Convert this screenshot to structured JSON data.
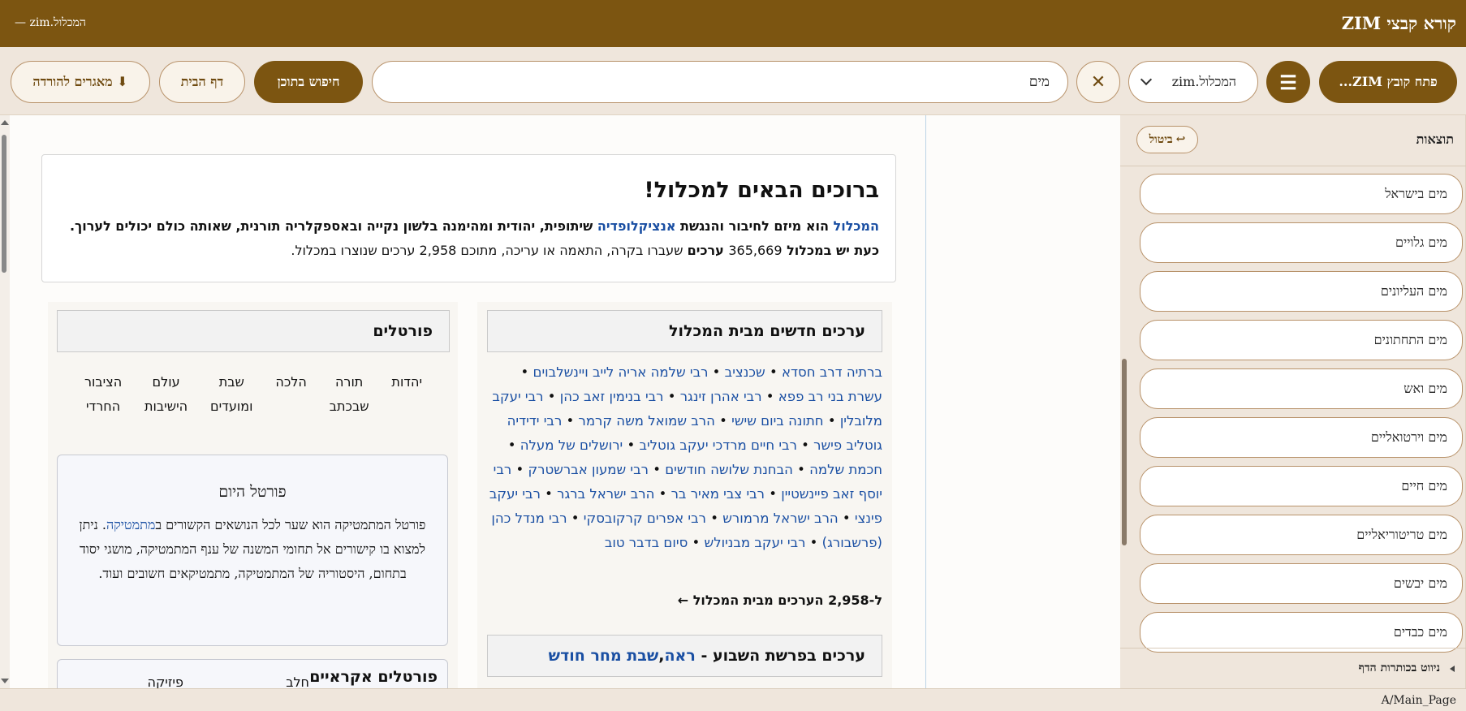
{
  "window": {
    "app_title": "קורא קבצי ZIM",
    "doc_title": "המכלול.zim —"
  },
  "toolbar": {
    "open_label": "פתח קובץ ZIM...",
    "menu_glyph": "☰",
    "zim_selected": "המכלול.zim",
    "clear_glyph": "✕",
    "search_value": "מים",
    "fulltext_label": "חיפוש בתוכן",
    "home_label": "דף הבית",
    "repo_label": "⬇ מאגרים להורדה"
  },
  "welcome": {
    "title": "ברוכים הבאים למכלול!",
    "link_hamichlol": "המכלול",
    "text_1": " הוא מיזם לחיבור והנגשת ",
    "link_encyclopedia": "אנציקלופדיה",
    "text_2": " שיתופית, יהודית ומהימנה בלשון נקייה ובאספקלריה תורנית, שאותה כולם יכולים לערוך. כעת יש במכלול ",
    "count_total": "365,669",
    "text_3": " ערכים",
    "text_4": " שעברו בקרה, התאמה או עריכה, מתוכם ",
    "count_created": "2,958",
    "text_5": " ערכים שנוצרו במכלול."
  },
  "new_articles": {
    "heading": "ערכים חדשים מבית המכלול",
    "items": [
      "ברתיה דרב חסדא",
      "שכנציב",
      "רבי שלמה אריה לייב ויינשלבוים",
      "עשרת בני רב פפא",
      "רבי אהרן זינגר",
      "רבי בנימין זאב כהן",
      "רבי יעקב מלובלין",
      "חתונה ביום שישי",
      "הרב שמואל משה קרמר",
      "רבי ידידיה גוטליב פישר",
      "רבי חיים מרדכי יעקב גוטליב",
      "ירושלים של מעלה",
      "חכמת שלמה",
      "הבחנת שלושה חודשים",
      "רבי שמעון אברשטרק",
      "רבי יוסף זאב פיינשטיין",
      "רבי צבי מאיר בר",
      "הרב ישראל ברגר",
      "רבי יעקב פינצי",
      "הרב ישראל מרמורש",
      "רבי אפרים קרקובסקי",
      "רבי מנדל כהן (פרשבורג)",
      "רבי יעקב מבניולש",
      "סיום בדבר טוב"
    ],
    "more_prefix": "ל-",
    "more_count": "2,958",
    "more_suffix": " הערכים מבית המכלול ←"
  },
  "parasha": {
    "heading_prefix": "ערכים בפרשת השבוע - ",
    "link_1": "ראה",
    "link_sep": ", ",
    "link_2": "שבת מחר חודש"
  },
  "portals": {
    "heading": "פורטלים",
    "items": [
      [
        "יהדות"
      ],
      [
        "תורה",
        "שבכתב"
      ],
      [
        "הלכה"
      ],
      [
        "שבת",
        "ומועדים"
      ],
      [
        "עולם",
        "הישיבות"
      ],
      [
        "הציבור",
        "החרדי"
      ]
    ]
  },
  "daily_portal": {
    "heading": "פורטל היום",
    "text_1": "פורטל המתמטיקה הוא שער לכל הנושאים הקשורים ב",
    "link_math": "מתמטיקה",
    "text_2": ". ניתן למצוא בו קישורים אל תחומי המשנה של ענף המתמטיקה, מושגי יסוד בתחום, היסטוריה של המתמטיקה, מתמטיקאים חשובים ועוד."
  },
  "random_portals": {
    "heading": "פורטלים אקראיים",
    "item_1": "חלב",
    "item_2": "פיזיקה"
  },
  "results": {
    "title": "תוצאות",
    "cancel_label": "ביטול",
    "cancel_glyph": "↩",
    "items": [
      "מים בישראל",
      "מים גלויים",
      "מים העליונים",
      "מים התחתונים",
      "מים ואש",
      "מים וירטואליים",
      "מים חיים",
      "מים טריטוריאליים",
      "מים יבשים",
      "מים כבדים"
    ],
    "toc_label": "ניווט בכותרות הדף"
  },
  "status": {
    "url": "A/Main_Page"
  }
}
